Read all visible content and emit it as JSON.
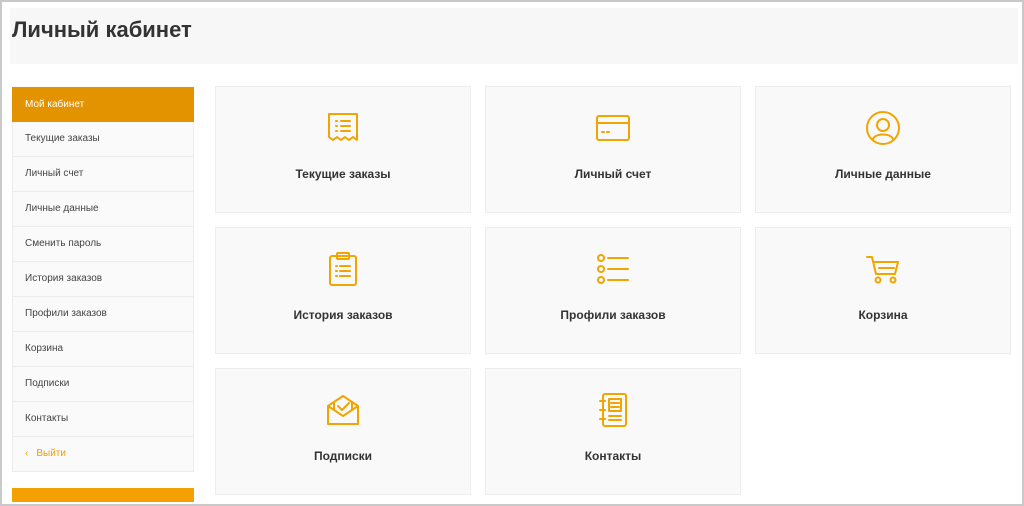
{
  "page": {
    "title": "Личный кабинет"
  },
  "colors": {
    "accent": "#e39300",
    "accent_light": "#f3a000"
  },
  "sidebar": {
    "items": [
      {
        "label": "Мой кабинет",
        "active": true
      },
      {
        "label": "Текущие заказы"
      },
      {
        "label": "Личный счет"
      },
      {
        "label": "Личные данные"
      },
      {
        "label": "Сменить пароль"
      },
      {
        "label": "История заказов"
      },
      {
        "label": "Профили заказов"
      },
      {
        "label": "Корзина"
      },
      {
        "label": "Подписки"
      },
      {
        "label": "Контакты"
      }
    ],
    "logout": {
      "label": "Выйти",
      "icon": "chevron-left-icon"
    }
  },
  "tiles": [
    {
      "label": "Текущие заказы",
      "icon": "receipt-icon"
    },
    {
      "label": "Личный счет",
      "icon": "credit-card-icon"
    },
    {
      "label": "Личные данные",
      "icon": "user-circle-icon"
    },
    {
      "label": "История заказов",
      "icon": "clipboard-icon"
    },
    {
      "label": "Профили заказов",
      "icon": "list-icon"
    },
    {
      "label": "Корзина",
      "icon": "cart-icon"
    },
    {
      "label": "Подписки",
      "icon": "envelope-check-icon"
    },
    {
      "label": "Контакты",
      "icon": "notebook-icon"
    }
  ]
}
